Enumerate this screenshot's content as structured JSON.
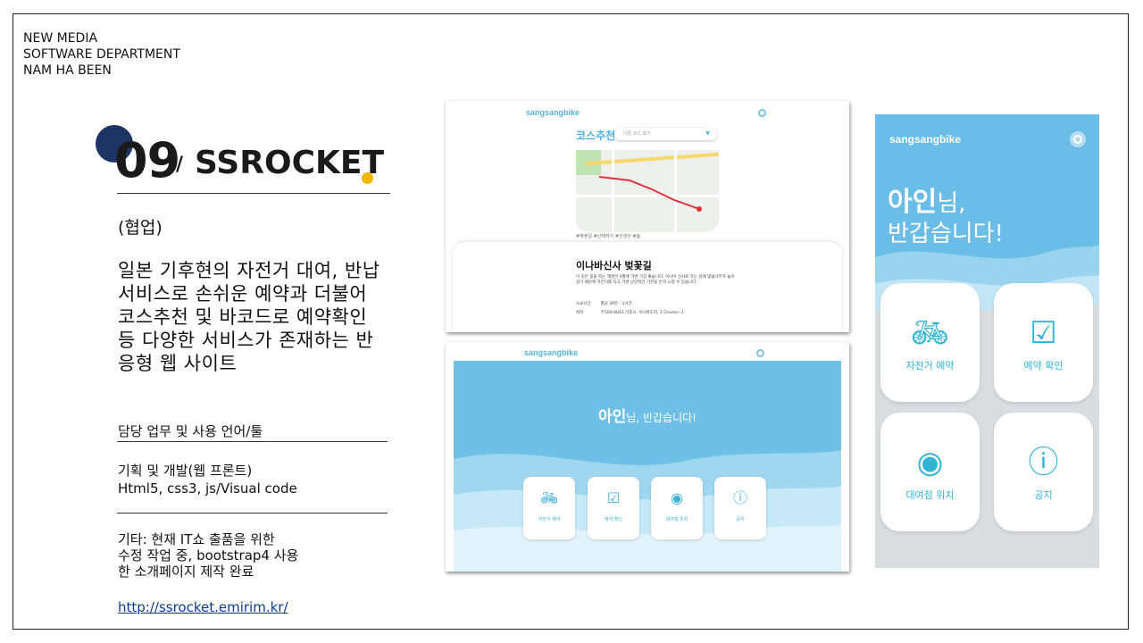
{
  "header": {
    "lines": [
      "NEW MEDIA",
      "SOFTWARE DEPARTMENT",
      "NAM HA BEEN"
    ]
  },
  "title": {
    "number": "09",
    "slash": "/",
    "name": "SSROCKET"
  },
  "collab": "(협업)",
  "description": [
    "일본 기후현의 자전거 대여, 반납",
    "서비스로 손쉬운 예약과 더불어",
    "코스추천 및 바코드로 예약확인",
    "등 다양한 서비스가 존재하는 반",
    "응형 웹 사이트"
  ],
  "role": {
    "title": "담당 업무 및 사용 언어/툴",
    "lines": [
      "기획 및 개발(웹 프론트)",
      "Html5, css3, js/Visual code"
    ]
  },
  "etc": {
    "lines": [
      "기타: 현재 IT쇼 출품을 위한",
      "수정 작업 중, bootstrap4 사용",
      "한 소개페이지 제작 완료"
    ]
  },
  "link": "http://ssrocket.emirim.kr/",
  "colors": {
    "accent": "#1e3463",
    "dot": "#f4b800",
    "sky": "#6abde6",
    "icon": "#2fb4d6"
  },
  "shot_course": {
    "brand": "sangsangbike",
    "section_title": "코스추천",
    "select_placeholder": "다른 코스 보기",
    "hashtags": "#벚꽃길 #산책하기 #인생샷 #봄",
    "place_title": "이나바신사 벚꽃길",
    "place_desc": "이 길은 봄을 피는 계절만 4월에 가면 가장 좋습니다. 이나바 신사로 가는 길에 벚꽃나무가 늘어섰기 때문에 자전거를 타고 가면 낭만적인 기분을 만끽 느낄 수 있습니다.",
    "rows": [
      {
        "key": "소요시간",
        "value": "평균 30분 - 1시간"
      },
      {
        "key": "위치",
        "value": "〒500-8043 기후시, 이나바도리, 1 Chome−1"
      }
    ]
  },
  "shot_desktop": {
    "brand": "sangsangbike",
    "greeting_name": "아인",
    "greeting_rest": "님, 반갑습니다!",
    "cards": [
      {
        "label": "자전거 예약",
        "icon": "bicycle-icon"
      },
      {
        "label": "예약 확인",
        "icon": "clipboard-check-icon"
      },
      {
        "label": "대여점 위치",
        "icon": "map-pin-icon"
      },
      {
        "label": "공지",
        "icon": "exclamation-icon"
      }
    ]
  },
  "shot_mobile": {
    "brand": "sangsangbike",
    "greeting_name": "아인",
    "greeting_suffix": "님,",
    "greeting_line2": "반갑습니다!",
    "cards": [
      {
        "label": "자전거 예약",
        "icon": "bicycle-icon"
      },
      {
        "label": "예약 확인",
        "icon": "clipboard-check-icon"
      },
      {
        "label": "대여점 위치",
        "icon": "map-pin-icon"
      },
      {
        "label": "공지",
        "icon": "exclamation-icon"
      }
    ]
  }
}
